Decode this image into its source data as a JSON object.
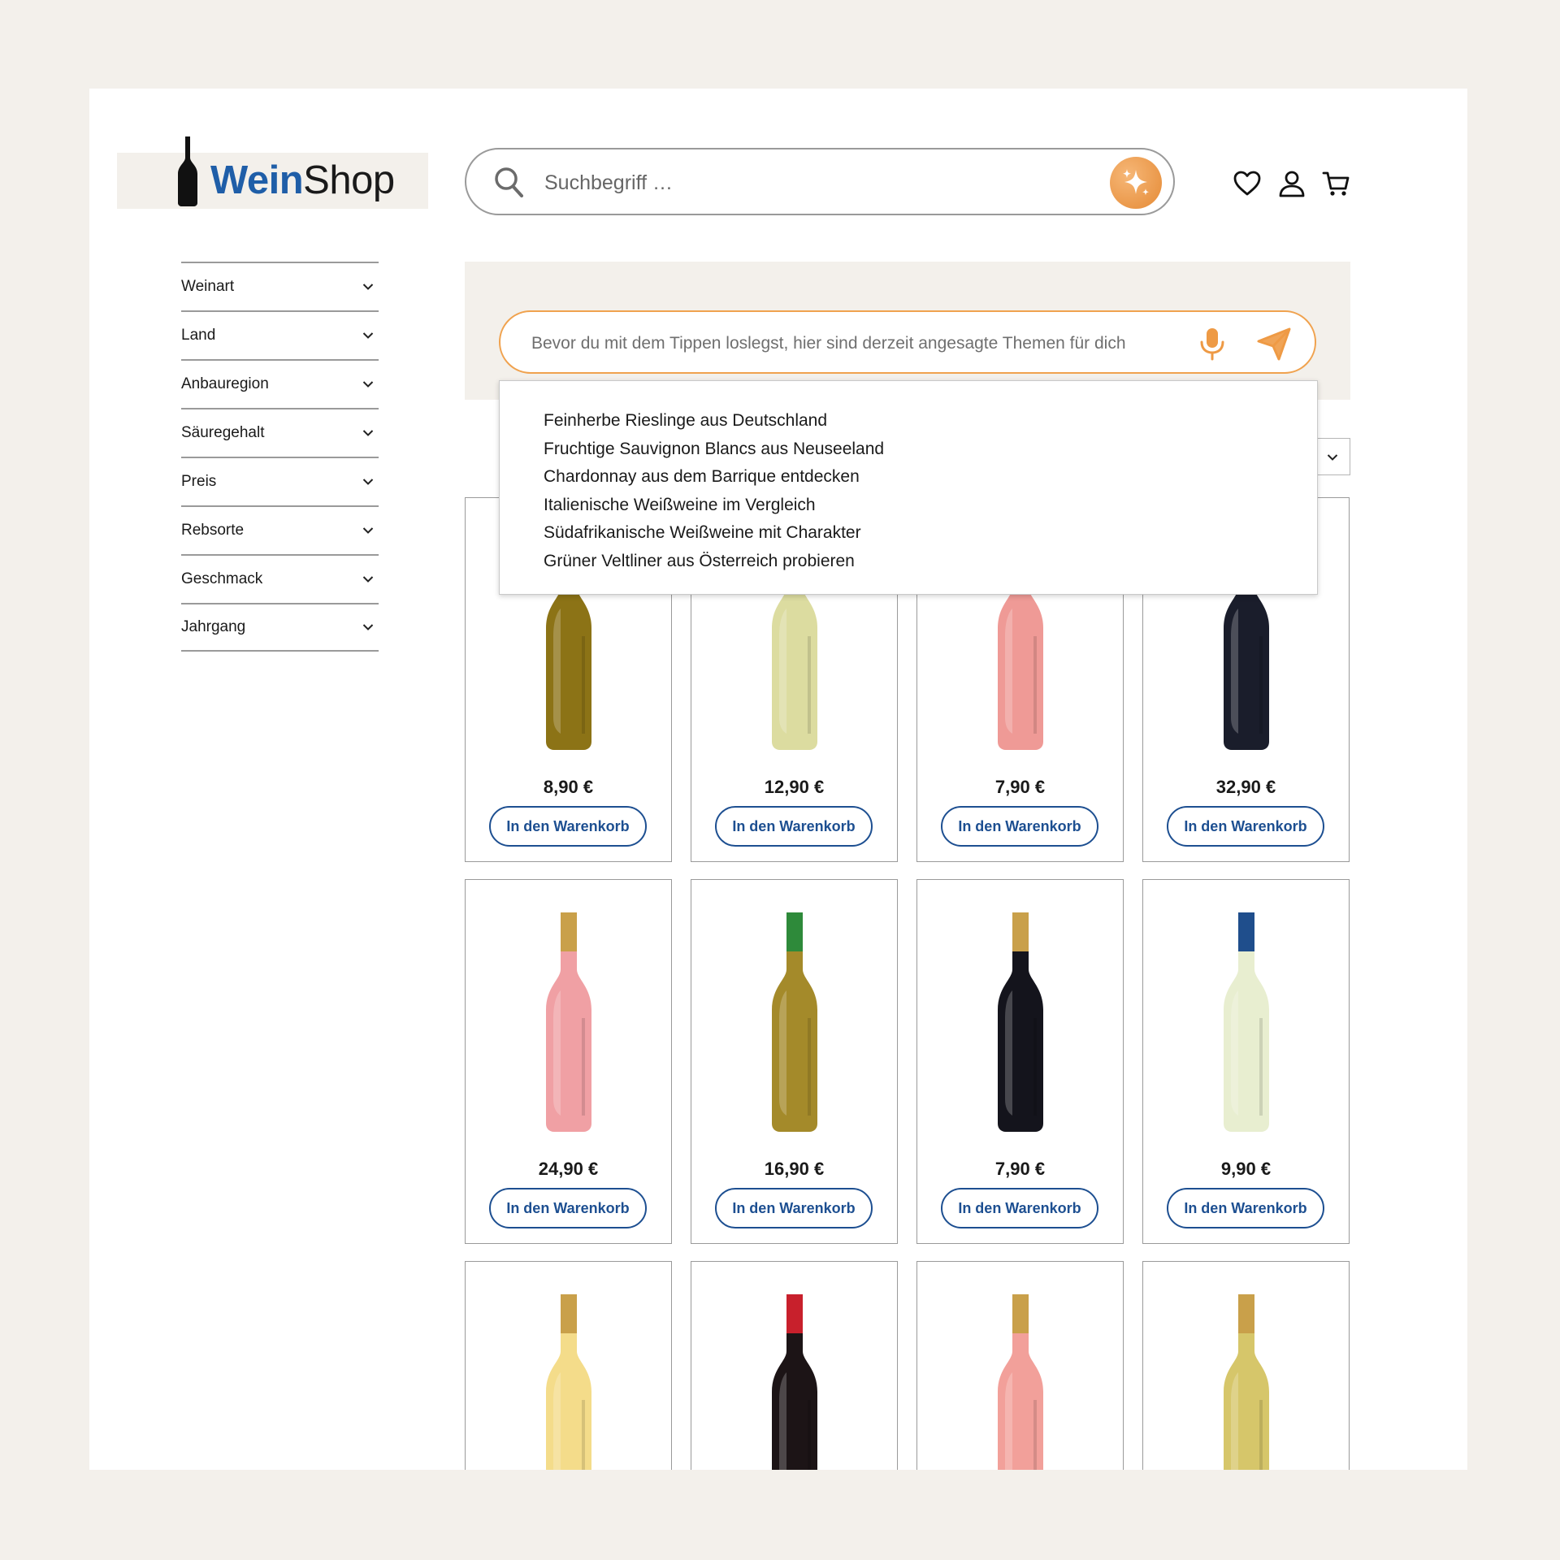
{
  "logo": {
    "part1": "Wein",
    "part2": "Shop"
  },
  "search": {
    "placeholder": "Suchbegriff …"
  },
  "header_icons": [
    "heart-icon",
    "user-icon",
    "cart-icon"
  ],
  "filters": [
    "Weinart",
    "Land",
    "Anbauregion",
    "Säuregehalt",
    "Preis",
    "Rebsorte",
    "Geschmack",
    "Jahrgang"
  ],
  "assistant": {
    "placeholder": "Bevor du mit dem Tippen loslegst, hier sind derzeit angesagte Themen für dich",
    "suggestions": [
      "Feinherbe Rieslinge aus Deutschland",
      "Fruchtige Sauvignon Blancs aus Neuseeland",
      "Chardonnay aus dem Barrique entdecken",
      "Italienische Weißweine im Vergleich",
      "Südafrikanische Weißweine mit Charakter",
      "Grüner Veltliner aus Österreich probieren"
    ]
  },
  "products": [
    {
      "price": "8,90 €",
      "button": "In den Warenkorb",
      "wine": "#8c7316",
      "cap": "#8c7316"
    },
    {
      "price": "12,90 €",
      "button": "In den Warenkorb",
      "wine": "#dcdca0",
      "cap": "#dcdca0"
    },
    {
      "price": "7,90 €",
      "button": "In den Warenkorb",
      "wine": "#ef9a96",
      "cap": "#ef9a96"
    },
    {
      "price": "32,90 €",
      "button": "In den Warenkorb",
      "wine": "#1a1d2b",
      "cap": "#1a1d2b"
    },
    {
      "price": "24,90 €",
      "button": "In den Warenkorb",
      "wine": "#f0a0a4",
      "cap": "#c9a04a"
    },
    {
      "price": "16,90 €",
      "button": "In den Warenkorb",
      "wine": "#a48a2a",
      "cap": "#2e8a3a"
    },
    {
      "price": "7,90 €",
      "button": "In den Warenkorb",
      "wine": "#14141c",
      "cap": "#c9a04a"
    },
    {
      "price": "9,90 €",
      "button": "In den Warenkorb",
      "wine": "#e8eed0",
      "cap": "#1f4e8c"
    },
    {
      "wine": "#f4dc8a",
      "cap": "#c9a04a"
    },
    {
      "wine": "#1c1416",
      "cap": "#c8202c"
    },
    {
      "wine": "#f2a09a",
      "cap": "#c9a04a"
    },
    {
      "wine": "#d6c66a",
      "cap": "#c9a04a"
    }
  ]
}
